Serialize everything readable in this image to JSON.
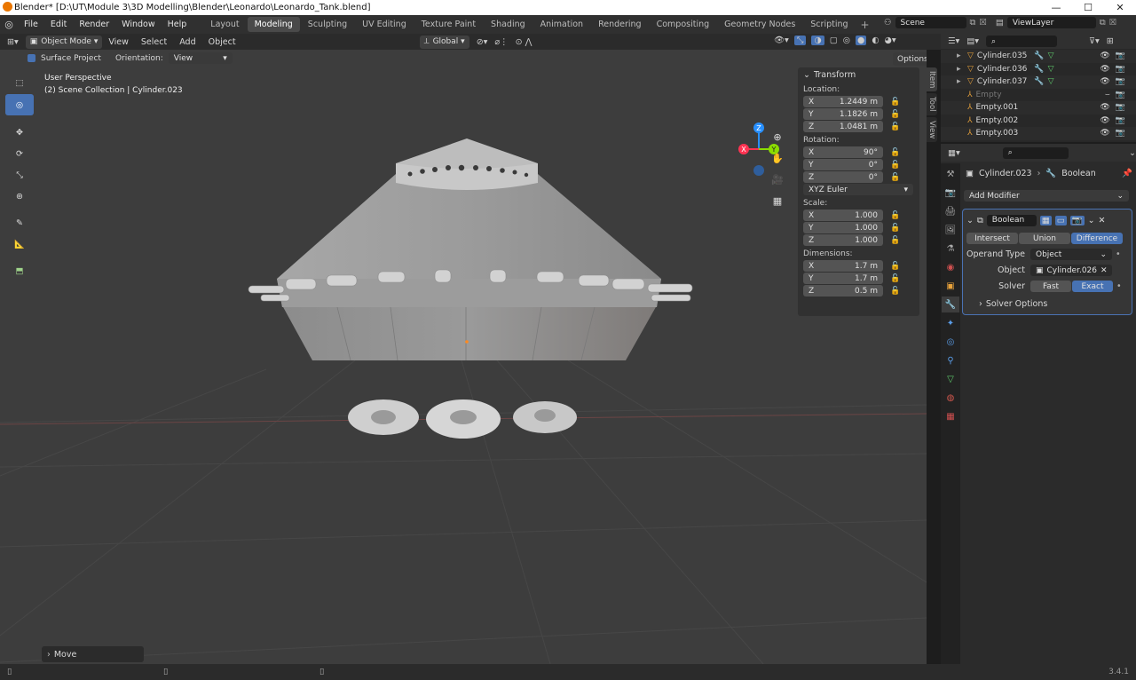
{
  "window": {
    "title": "Blender* [D:\\UT\\Module 3\\3D Modelling\\Blender\\Leonardo\\Leonardo_Tank.blend]"
  },
  "menu": [
    "File",
    "Edit",
    "Render",
    "Window",
    "Help"
  ],
  "workspaces": [
    "Layout",
    "Modeling",
    "Sculpting",
    "UV Editing",
    "Texture Paint",
    "Shading",
    "Animation",
    "Rendering",
    "Compositing",
    "Geometry Nodes",
    "Scripting"
  ],
  "active_workspace": "Modeling",
  "scene": "Scene",
  "view_layer": "ViewLayer",
  "header": {
    "mode": "Object Mode",
    "menus": [
      "View",
      "Select",
      "Add",
      "Object"
    ],
    "orientation_global": "Global"
  },
  "toolsettings": {
    "surface_project": "Surface Project",
    "orientation_label": "Orientation:",
    "orientation_value": "View",
    "options": "Options"
  },
  "viewport": {
    "perspective": "User Perspective",
    "collection": "(2) Scene Collection | Cylinder.023"
  },
  "gizmo": {
    "x": "X",
    "y": "Y",
    "z": "Z"
  },
  "npanel": {
    "title": "Transform",
    "location_label": "Location:",
    "location": [
      {
        "axis": "X",
        "value": "1.2449 m"
      },
      {
        "axis": "Y",
        "value": "1.1826 m"
      },
      {
        "axis": "Z",
        "value": "1.0481 m"
      }
    ],
    "rotation_label": "Rotation:",
    "rotation": [
      {
        "axis": "X",
        "value": "90°"
      },
      {
        "axis": "Y",
        "value": "0°"
      },
      {
        "axis": "Z",
        "value": "0°"
      }
    ],
    "rotation_mode": "XYZ Euler",
    "scale_label": "Scale:",
    "scale": [
      {
        "axis": "X",
        "value": "1.000"
      },
      {
        "axis": "Y",
        "value": "1.000"
      },
      {
        "axis": "Z",
        "value": "1.000"
      }
    ],
    "dimensions_label": "Dimensions:",
    "dimensions": [
      {
        "axis": "X",
        "value": "1.7 m"
      },
      {
        "axis": "Y",
        "value": "1.7 m"
      },
      {
        "axis": "Z",
        "value": "0.5 m"
      }
    ],
    "tabs": [
      "Item",
      "Tool",
      "View"
    ]
  },
  "outliner": {
    "items": [
      {
        "name": "Cylinder.035"
      },
      {
        "name": "Cylinder.036"
      },
      {
        "name": "Cylinder.037"
      },
      {
        "name": "Empty"
      },
      {
        "name": "Empty.001"
      },
      {
        "name": "Empty.002"
      },
      {
        "name": "Empty.003"
      }
    ]
  },
  "properties": {
    "object": "Cylinder.023",
    "modifier_crumb": "Boolean",
    "add_modifier": "Add Modifier",
    "modifier_name": "Boolean",
    "ops": [
      "Intersect",
      "Union",
      "Difference"
    ],
    "active_op": "Difference",
    "operand_label": "Operand Type",
    "operand_value": "Object",
    "object_label": "Object",
    "object_value": "Cylinder.026",
    "solver_label": "Solver",
    "solver_options": [
      "Fast",
      "Exact"
    ],
    "active_solver": "Exact",
    "solver_options_label": "Solver Options"
  },
  "last_op": "Move",
  "version": "3.4.1",
  "colors": {
    "accent": "#4772b3",
    "x_axis": "#ff3352",
    "y_axis": "#8bdc00",
    "z_axis": "#2890ff"
  }
}
